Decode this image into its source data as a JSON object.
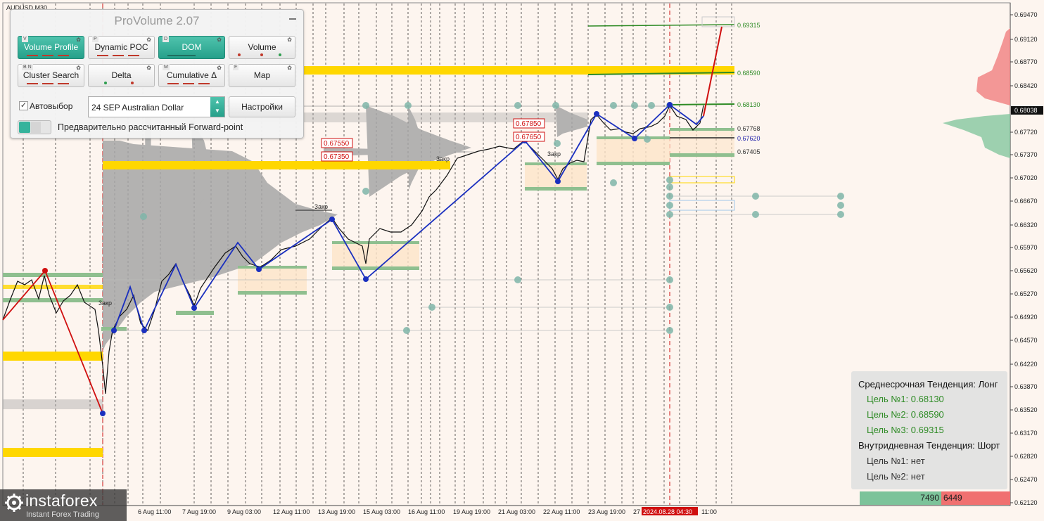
{
  "symbol": "AUDUSD,M30",
  "panel": {
    "title": "ProVolume 2.07",
    "buttons": [
      {
        "label": "Volume Profile",
        "key": "V",
        "active": true
      },
      {
        "label": "Dynamic POC",
        "key": "P",
        "active": false
      },
      {
        "label": "DOM",
        "key": "D",
        "active": true
      },
      {
        "label": "Volume",
        "key": "",
        "active": false
      },
      {
        "label": "Cluster Search",
        "key": "B N",
        "active": false
      },
      {
        "label": "Delta",
        "key": "",
        "active": false
      },
      {
        "label": "Cumulative Δ",
        "key": "M",
        "active": false
      },
      {
        "label": "Map",
        "key": "F",
        "active": false
      }
    ],
    "autoselect_label": "Автовыбор",
    "autoselect_checked": "✓",
    "instrument": "24 SEP Australian Dollar",
    "settings_label": "Настройки",
    "forward_label": "Предварительно рассчитанный Forward-point"
  },
  "price_axis": [
    "0.69470",
    "0.69120",
    "0.68770",
    "0.68420",
    "0.68038",
    "0.67720",
    "0.67370",
    "0.67020",
    "0.66670",
    "0.66320",
    "0.65970",
    "0.65620",
    "0.65270",
    "0.64920",
    "0.64570",
    "0.64220",
    "0.63870",
    "0.63520",
    "0.63170",
    "0.62820",
    "0.62470",
    "0.62120"
  ],
  "current_price": "0.68038",
  "time_axis": [
    "6 Aug 11:00",
    "7 Aug 19:00",
    "9 Aug 03:00",
    "12 Aug 11:00",
    "13 Aug 19:00",
    "15 Aug 03:00",
    "16 Aug 11:00",
    "19 Aug 19:00",
    "21 Aug 03:00",
    "22 Aug 11:00",
    "23 Aug 19:00",
    "27",
    "2024.08.28 04:30",
    "11:00"
  ],
  "level_labels": [
    {
      "text": "0.69315",
      "color": "#2e8b25"
    },
    {
      "text": "0.68590",
      "color": "#2e8b25"
    },
    {
      "text": "0.68130",
      "color": "#2e8b25"
    },
    {
      "text": "0.67768",
      "color": "#333333"
    },
    {
      "text": "0.67620",
      "color": "#2222aa"
    },
    {
      "text": "0.67405",
      "color": "#333333"
    }
  ],
  "red_tags": [
    "0.67850",
    "0.67650",
    "0.67550",
    "0.67350"
  ],
  "small_labels": [
    "3акр",
    "3акр",
    "3акр",
    "3акр"
  ],
  "trend_box": {
    "medium_title": "Среднесрочная Тенденция: Лонг",
    "medium_targets": [
      "Цель №1: 0.68130",
      "Цель №2: 0.68590",
      "Цель №3: 0.69315"
    ],
    "intraday_title": "Внутридневная Тенденция: Шорт",
    "intraday_targets": [
      "Цель №1: нет",
      "Цель №2: нет"
    ]
  },
  "volume_split": {
    "buy": "7490",
    "sell": "6449"
  },
  "logo": {
    "name": "instaforex",
    "tagline": "Instant Forex Trading"
  },
  "colors": {
    "background": "#fdf5ef",
    "bull": "#2e8b25",
    "bear": "#d01010",
    "zigzag": "#1a2fbf",
    "volume": "#a0a0a0",
    "level_yellow": "#ffd700",
    "panel_accent": "#2fae96"
  }
}
